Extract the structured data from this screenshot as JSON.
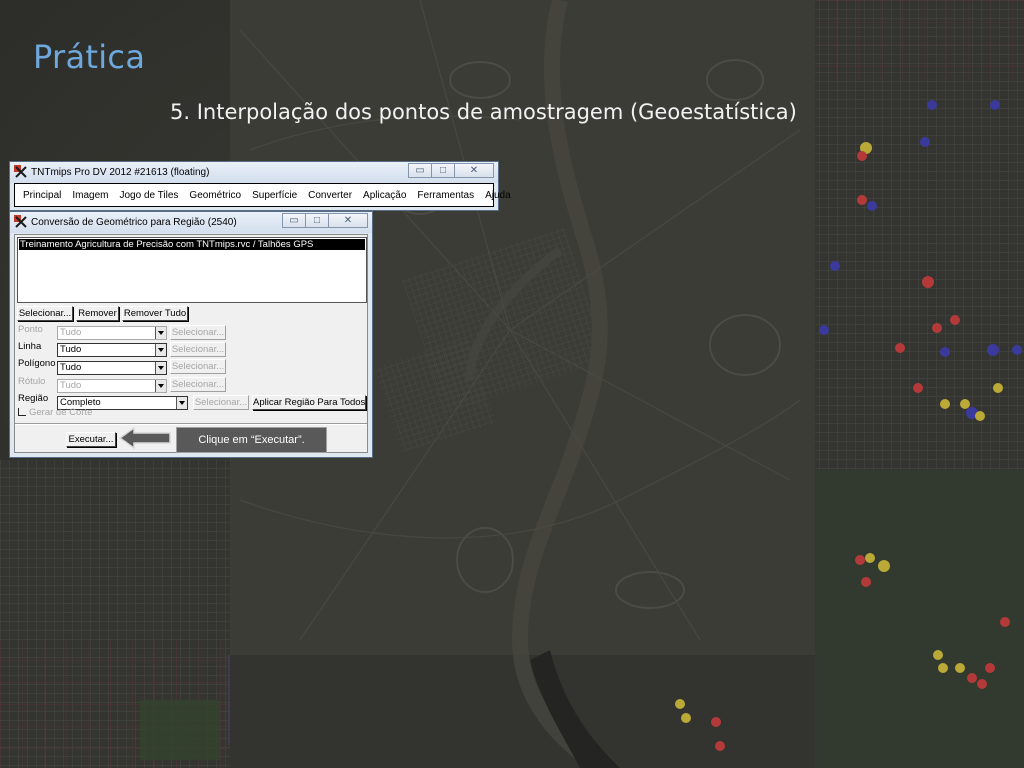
{
  "slide": {
    "title": "Prática",
    "subtitle": "5. Interpolação dos pontos de amostragem (Geoestatística)"
  },
  "main_window": {
    "title": "TNTmips Pro DV 2012  #21613 (floating)",
    "menu": [
      "Principal",
      "Imagem",
      "Jogo de Tiles",
      "Geométrico",
      "Superfície",
      "Converter",
      "Aplicação",
      "Ferramentas",
      "Ajuda"
    ]
  },
  "conversion_dialog": {
    "title": "Conversão de Geométrico para Região (2540)",
    "selected_file": "Treinamento Agricultura de Precisão com TNTmips.rvc / Talhões GPS",
    "buttons": {
      "select": "Selecionar...",
      "remove": "Remover",
      "remove_all": "Remover Tudo",
      "apply_region_all": "Aplicar Região Para Todos",
      "execute": "Executar..."
    },
    "rows": [
      {
        "label": "Ponto",
        "value": "Tudo",
        "enabled": false,
        "select": "Selecionar..."
      },
      {
        "label": "Linha",
        "value": "Tudo",
        "enabled": true,
        "select": "Selecionar..."
      },
      {
        "label": "Polígono",
        "value": "Tudo",
        "enabled": true,
        "select": "Selecionar..."
      },
      {
        "label": "Rótulo",
        "value": "Tudo",
        "enabled": false,
        "select": "Selecionar..."
      }
    ],
    "region": {
      "label": "Região",
      "value": "Completo",
      "select": "Selecionar..."
    },
    "clip_checkbox": {
      "label": "Gerar  de Corte",
      "checked": false
    }
  },
  "callout": {
    "text": "Clique em “Executar”."
  },
  "colors": {
    "title_blue": "#6fa8dc",
    "background": "#3d3e38",
    "callout_bg": "#595959"
  },
  "icons": [
    "tntmips-app-icon",
    "minimize-icon",
    "maximize-icon",
    "close-icon",
    "dropdown-arrow-icon",
    "left-arrow-icon"
  ]
}
